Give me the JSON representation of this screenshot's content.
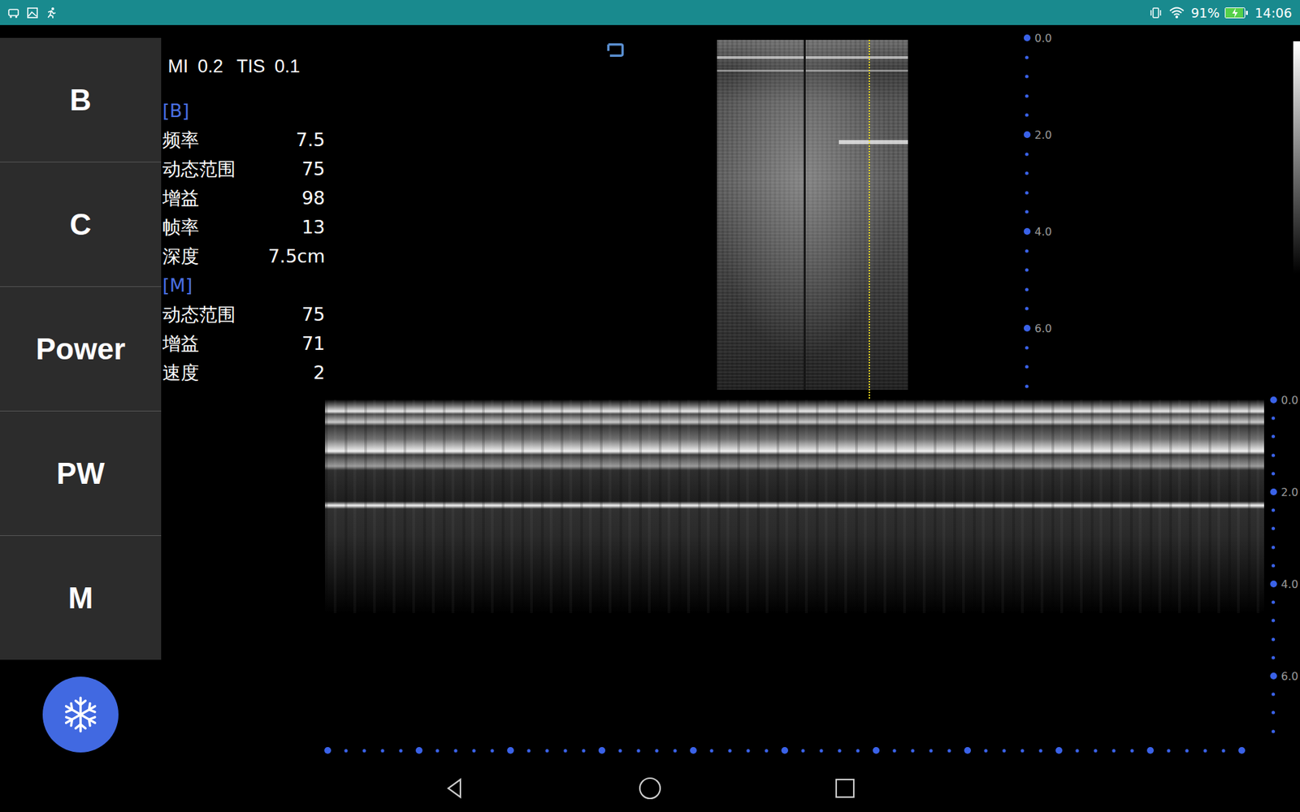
{
  "status_bar": {
    "battery": "91%",
    "battery_level": 0.91,
    "charging": true,
    "time": "14:06"
  },
  "modes": [
    "B",
    "C",
    "Power",
    "PW",
    "M"
  ],
  "indices": {
    "mi_label": "MI",
    "mi": "0.2",
    "tis_label": "TIS",
    "tis": "0.1"
  },
  "sections": [
    {
      "title": "[B]",
      "params": [
        {
          "name": "频率",
          "value": "7.5"
        },
        {
          "name": "动态范围",
          "value": "75"
        },
        {
          "name": "增益",
          "value": "98"
        },
        {
          "name": "帧率",
          "value": "13"
        },
        {
          "name": "深度",
          "value": "7.5cm"
        }
      ]
    },
    {
      "title": "[M]",
      "params": [
        {
          "name": "动态范围",
          "value": "75"
        },
        {
          "name": "增益",
          "value": "71"
        },
        {
          "name": "速度",
          "value": "2"
        }
      ]
    }
  ],
  "b_scale": [
    "0.0",
    "2.0",
    "4.0",
    "6.0"
  ],
  "m_scale": [
    "0.0",
    "2.0",
    "4.0",
    "6.0"
  ]
}
